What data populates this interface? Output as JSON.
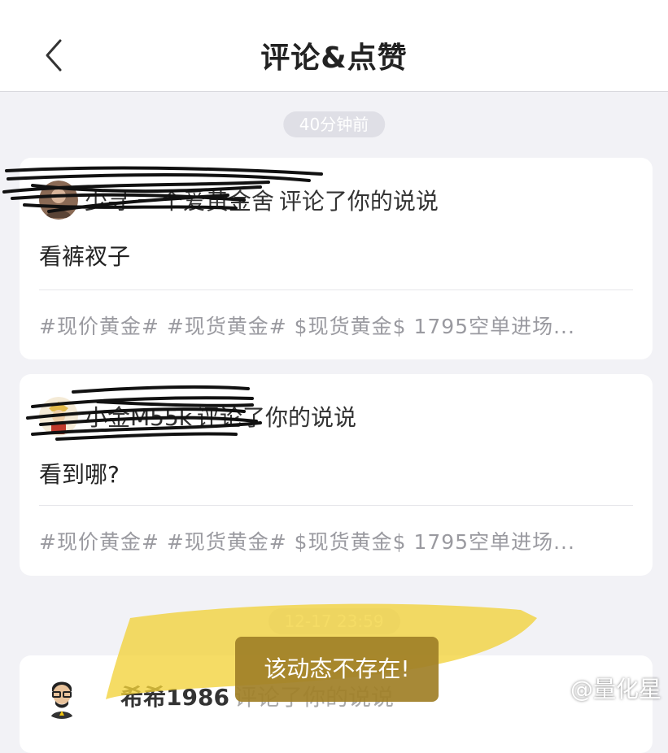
{
  "header": {
    "title": "评论&点赞",
    "back_icon": "chevron-left-icon"
  },
  "groups": [
    {
      "time": "40分钟前",
      "cards": [
        {
          "user_name": "少寻 一个爱黄金舍",
          "action": "评论了你的说说",
          "comment": "看裤衩子",
          "post_excerpt": "#现价黄金# #现货黄金# $现货黄金$ 1795空单进场..."
        },
        {
          "user_name": "小金M55k",
          "action": "评论了你的说说",
          "comment": "看到哪?",
          "post_excerpt": "#现价黄金# #现货黄金# $现货黄金$ 1795空单进场..."
        }
      ]
    },
    {
      "time": "12-17 23:59",
      "cards": [
        {
          "user_name": "希希1986",
          "action": "评论了你的说说"
        }
      ]
    }
  ],
  "toast": {
    "message": "该动态不存在!"
  },
  "watermark": {
    "text": "@量化星"
  },
  "colors": {
    "background": "#f2f2f6",
    "card": "#ffffff",
    "time_pill": "#dfdfe6",
    "toast": "#a08028",
    "highlighter": "#f2d23a"
  }
}
